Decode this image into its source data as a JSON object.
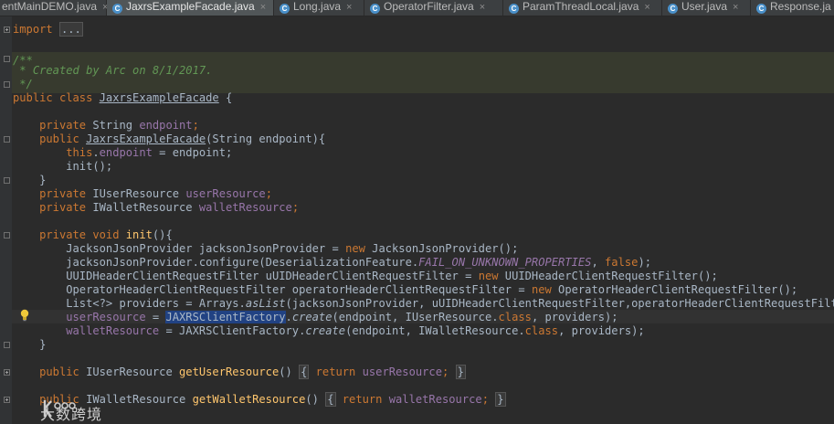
{
  "tabs": [
    {
      "label": "entMainDEMO.java",
      "active": false,
      "icon": "java-class-icon"
    },
    {
      "label": "JaxrsExampleFacade.java",
      "active": true,
      "icon": "java-class-icon"
    },
    {
      "label": "Long.java",
      "active": false,
      "icon": "java-class-icon"
    },
    {
      "label": "OperatorFilter.java",
      "active": false,
      "icon": "java-class-icon"
    },
    {
      "label": "ParamThreadLocal.java",
      "active": false,
      "icon": "java-class-icon"
    },
    {
      "label": "User.java",
      "active": false,
      "icon": "java-class-icon"
    },
    {
      "label": "Response.ja",
      "active": false,
      "icon": "java-class-icon"
    }
  ],
  "code": {
    "import_kw": "import",
    "import_fold": "...",
    "comment_open": "/**",
    "comment_body": " * Created by Arc on 8/1/2017.",
    "comment_close": " */",
    "class_decl_kw": "public class",
    "class_name": "JaxrsExampleFacade",
    "class_brace": " {",
    "l_endpoint": {
      "kw": "private",
      "type": " String ",
      "name": "endpoint",
      "end": ";"
    },
    "l_ctor": {
      "kw": "public",
      "name": "JaxrsExampleFacade",
      "args": "(String endpoint){"
    },
    "l_this": {
      "kw": "this",
      "dot": ".",
      "field": "endpoint",
      "rest": " = endpoint;"
    },
    "l_initcall": "init();",
    "l_close1": "}",
    "l_userres": {
      "kw": "private",
      "type": " IUserResource ",
      "name": "userResource",
      "end": ";"
    },
    "l_walletres": {
      "kw": "private",
      "type": " IWalletResource ",
      "name": "walletResource",
      "end": ";"
    },
    "l_init_decl": {
      "kw": "private void",
      "name": "init",
      "rest": "(){"
    },
    "l_jackson": {
      "a": "JacksonJsonProvider jacksonJsonProvider = ",
      "kw": "new",
      "b": " JacksonJsonProvider();"
    },
    "l_configure": {
      "a": "jacksonJsonProvider.configure(DeserializationFeature.",
      "st": "FAIL_ON_UNKNOWN_PROPERTIES",
      "b": ", ",
      "kw": "false",
      "c": ");"
    },
    "l_uuid": {
      "a": "UUIDHeaderClientRequestFilter uUIDHeaderClientRequestFilter = ",
      "kw": "new",
      "b": " UUIDHeaderClientRequestFilter();"
    },
    "l_operator": {
      "a": "OperatorHeaderClientRequestFilter operatorHeaderClientRequestFilter = ",
      "kw": "new",
      "b": " OperatorHeaderClientRequestFilter();"
    },
    "l_list": {
      "a": "List<?> providers = Arrays.",
      "it": "asList",
      "b": "(jacksonJsonProvider, uUIDHeaderClientRequestFilter,operatorHeaderClientRequestFilter);"
    },
    "l_assign_user": {
      "field": "userResource",
      "eq": " = ",
      "sel": "JAXRSClientFactory",
      "dot": ".",
      "it": "create",
      "a": "(endpoint, IUserResource.",
      "kw": "class",
      "b": ", providers);"
    },
    "l_assign_wallet": {
      "field": "walletResource",
      "eq": " = JAXRSClientFactory.",
      "it": "create",
      "a": "(endpoint, IWalletResource.",
      "kw": "class",
      "b": ", providers);"
    },
    "l_close2": "}",
    "l_get_user": {
      "kw": "public",
      "type": " IUserResource ",
      "name": "getUserResource",
      "paren": "()",
      "open": "{",
      "ret": "return",
      "field": "userResource",
      "end": ";",
      "close": "}"
    },
    "l_get_wallet": {
      "kw": "public",
      "type": " IWalletResource ",
      "name": "getWalletResource",
      "paren": "()",
      "open": "{",
      "ret": "return",
      "field": "walletResource",
      "end": ";",
      "close": "}"
    }
  },
  "watermark": {
    "text": "大数跨境",
    "logo_icon": "kk-logo-icon"
  },
  "colors": {
    "keyword": "#cc7832",
    "field": "#9876aa",
    "comment": "#629755",
    "method": "#ffc66d",
    "text": "#a9b7c6",
    "background": "#2b2b2b"
  }
}
